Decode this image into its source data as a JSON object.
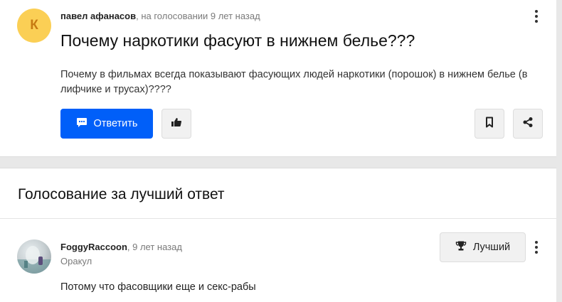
{
  "question": {
    "author_initial": "К",
    "author": "павел афанасов",
    "meta_suffix": ", на голосовании 9 лет назад",
    "title": "Почему наркотики фасуют в нижнем белье???",
    "body": "Почему в фильмах всегда показывают фасующих людей наркотики (порошок) в нижнем белье (в лифчике и трусах)????",
    "reply_label": "Ответить",
    "icons": [
      "chat-icon",
      "thumbs-up-icon",
      "bookmark-icon",
      "share-icon",
      "more-icon"
    ]
  },
  "voting": {
    "title": "Голосование за лучший ответ",
    "answer": {
      "author": "FoggyRaccoon",
      "meta_suffix": ", 9 лет назад",
      "rank": "Оракул",
      "text": "Потому что фасовщики еще и секс-рабы",
      "best_label": "Лучший"
    }
  },
  "colors": {
    "accent": "#005ff9",
    "avatar_bg": "#fbcf55",
    "avatar_fg": "#c77a12"
  }
}
